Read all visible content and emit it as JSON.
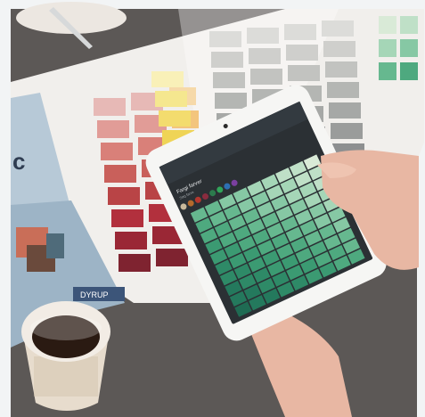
{
  "photo": {
    "subject": "hands-holding-tablet-over-color-fan-deck",
    "brand_text": "DYRUP",
    "brochure_letter": "c",
    "tablet_title": "Fargi farver",
    "tablet_subtitle": "Søg farve"
  },
  "colors": {
    "frame_white": "#f2f4f5",
    "table": "#5c5856",
    "brochure_paper": "#f1efec",
    "brochure_blue": "#9db4c6",
    "tablet_body": "#f6f6f4",
    "tablet_screen_dark": "#2b3034",
    "cup_outer": "#ede3d6",
    "coffee": "#2a1a12",
    "skin": "#e8b7a3"
  },
  "reds": [
    "#e7b9b6",
    "#e19c97",
    "#d98079",
    "#c9605b",
    "#b94446",
    "#b2303d",
    "#9a2735",
    "#7f2330"
  ],
  "oranges": [
    "#f6d9a9",
    "#f3c57d",
    "#efb04f",
    "#e89a48",
    "#d8793f",
    "#d1623b"
  ],
  "yellows": [
    "#f9f0b8",
    "#f5e78f",
    "#f3dc6e",
    "#efd456"
  ],
  "grays": [
    "#dcdcd9",
    "#cfcfcc",
    "#c2c3c0",
    "#b4b6b3",
    "#a6a8a6",
    "#9a9c9b",
    "#8d8f90",
    "#7e8083"
  ],
  "greens": [
    "#d9ead7",
    "#bfe0c7",
    "#a5d6b7",
    "#86c8a4",
    "#66b88f",
    "#4ea97f",
    "#3b9a72",
    "#2e8a67",
    "#24795d",
    "#1f6b53"
  ],
  "dots": [
    "#c9b99a",
    "#b46a2c",
    "#b3372e",
    "#8a2c3f",
    "#2c7b4d",
    "#31a55a",
    "#2d6fb3",
    "#7b3fa0"
  ]
}
